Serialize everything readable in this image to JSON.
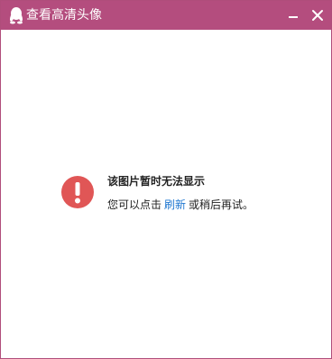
{
  "window": {
    "title": "查看高清头像",
    "accent": "#b44d7e",
    "icons": {
      "app": "qq-penguin-icon",
      "minimize": "minimize-icon",
      "close": "close-icon"
    }
  },
  "message": {
    "icon": "alert-icon",
    "icon_color": "#e05656",
    "title": "该图片暂时无法显示",
    "sub_prefix": "您可以点击",
    "refresh_link": "刷新",
    "sub_suffix": "或稍后再试。",
    "link_color": "#1f77d0"
  }
}
